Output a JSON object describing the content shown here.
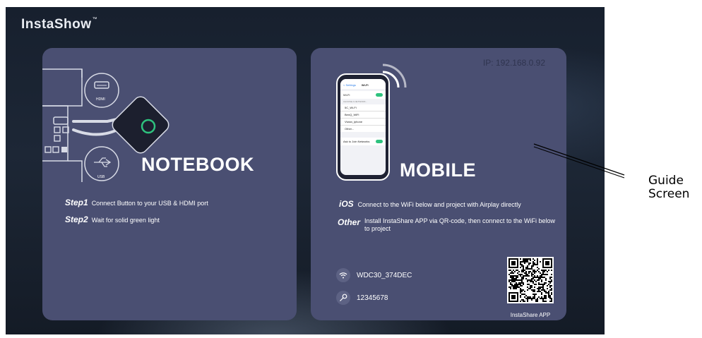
{
  "brand": {
    "name": "InstaShow",
    "trademark": "™"
  },
  "notebook": {
    "title": "NOTEBOOK",
    "icons": [
      "hdmi-icon",
      "usb-icon",
      "instashow-button-icon"
    ],
    "hdmi_label": "HDMI",
    "usb_label": "USB",
    "steps": [
      {
        "label": "Step1",
        "text": "Connect Button to your USB & HDMI port"
      },
      {
        "label": "Step2",
        "text": "Wait for solid green light"
      }
    ]
  },
  "mobile": {
    "ip": "IP: 192.168.0.92",
    "title": "MOBILE",
    "ios": {
      "label": "iOS",
      "text": "Connect to the WiFi below and project with Airplay directly"
    },
    "other": {
      "label": "Other",
      "text": "Install InstaShare APP via QR-code, then connect to the WiFi below to project"
    },
    "wifi_ssid": "WDC30_374DEC",
    "password": "12345678",
    "qr_label": "InstaShare APP",
    "phone": {
      "back": "< Settings",
      "screen_title": "Wi-Fi",
      "wifi_row": "Wi-Fi",
      "section": "CHOOSE A NETWORK...",
      "networks": [
        "5C_Wi-Fi",
        "BenQ_WiFi",
        "Vivian_iphone",
        "Other..."
      ],
      "ask_label": "Ask to Join Networks"
    }
  },
  "callout": {
    "label_line1": "Guide",
    "label_line2": "Screen"
  },
  "colors": {
    "panel": "#4a4f72",
    "accent_green": "#2ec27e",
    "background": "#1a2332"
  }
}
